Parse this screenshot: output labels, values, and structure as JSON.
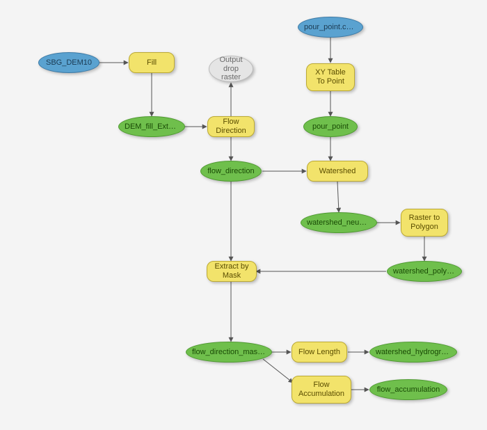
{
  "nodes": {
    "sbg_dem10": {
      "label": "SBG_DEM10",
      "type": "input",
      "shape": "blue-ellipse"
    },
    "pour_point_csv": {
      "label": "pour_point.csv…",
      "type": "input",
      "shape": "blue-ellipse"
    },
    "fill": {
      "label": "Fill",
      "type": "tool",
      "shape": "yellow-rect"
    },
    "xy_table_to_point": {
      "label": "XY Table To Point",
      "type": "tool",
      "shape": "yellow-rect"
    },
    "flow_direction_t": {
      "label": "Flow Direction",
      "type": "tool",
      "shape": "yellow-rect"
    },
    "watershed_t": {
      "label": "Watershed",
      "type": "tool",
      "shape": "yellow-rect"
    },
    "raster_to_polygon": {
      "label": "Raster to Polygon",
      "type": "tool",
      "shape": "yellow-rect"
    },
    "extract_by_mask": {
      "label": "Extract by Mask",
      "type": "tool",
      "shape": "yellow-rect"
    },
    "flow_length_t": {
      "label": "Flow Length",
      "type": "tool",
      "shape": "yellow-rect"
    },
    "flow_accum_t": {
      "label": "Flow Accumulation",
      "type": "tool",
      "shape": "yellow-rect"
    },
    "dem_fill_extent": {
      "label": "DEM_fill_Extent",
      "type": "data",
      "shape": "green-ellipse"
    },
    "output_drop": {
      "label": "Output drop raster",
      "type": "optional",
      "shape": "grey-ellipse"
    },
    "pour_point": {
      "label": "pour_point",
      "type": "data",
      "shape": "green-ellipse"
    },
    "flow_direction": {
      "label": "flow_direction",
      "type": "data",
      "shape": "green-ellipse"
    },
    "watershed_neubach": {
      "label": "watershed_neubach",
      "type": "data",
      "shape": "green-ellipse"
    },
    "watershed_polygon": {
      "label": "watershed_polygon",
      "type": "data",
      "shape": "green-ellipse"
    },
    "flow_dir_masked": {
      "label": "flow_direction_masked",
      "type": "data",
      "shape": "green-ellipse"
    },
    "watershed_hydro": {
      "label": "watershed_hydrograph",
      "type": "data",
      "shape": "green-ellipse"
    },
    "flow_accum": {
      "label": "flow_accumulation",
      "type": "data",
      "shape": "green-ellipse"
    }
  },
  "edges": [
    [
      "sbg_dem10",
      "fill"
    ],
    [
      "fill",
      "dem_fill_extent"
    ],
    [
      "dem_fill_extent",
      "flow_direction_t"
    ],
    [
      "flow_direction_t",
      "output_drop"
    ],
    [
      "flow_direction_t",
      "flow_direction"
    ],
    [
      "pour_point_csv",
      "xy_table_to_point"
    ],
    [
      "xy_table_to_point",
      "pour_point"
    ],
    [
      "pour_point",
      "watershed_t"
    ],
    [
      "flow_direction",
      "watershed_t"
    ],
    [
      "watershed_t",
      "watershed_neubach"
    ],
    [
      "watershed_neubach",
      "raster_to_polygon"
    ],
    [
      "raster_to_polygon",
      "watershed_polygon"
    ],
    [
      "watershed_polygon",
      "extract_by_mask"
    ],
    [
      "flow_direction",
      "extract_by_mask"
    ],
    [
      "extract_by_mask",
      "flow_dir_masked"
    ],
    [
      "flow_dir_masked",
      "flow_length_t"
    ],
    [
      "flow_dir_masked",
      "flow_accum_t"
    ],
    [
      "flow_length_t",
      "watershed_hydro"
    ],
    [
      "flow_accum_t",
      "flow_accum"
    ]
  ]
}
